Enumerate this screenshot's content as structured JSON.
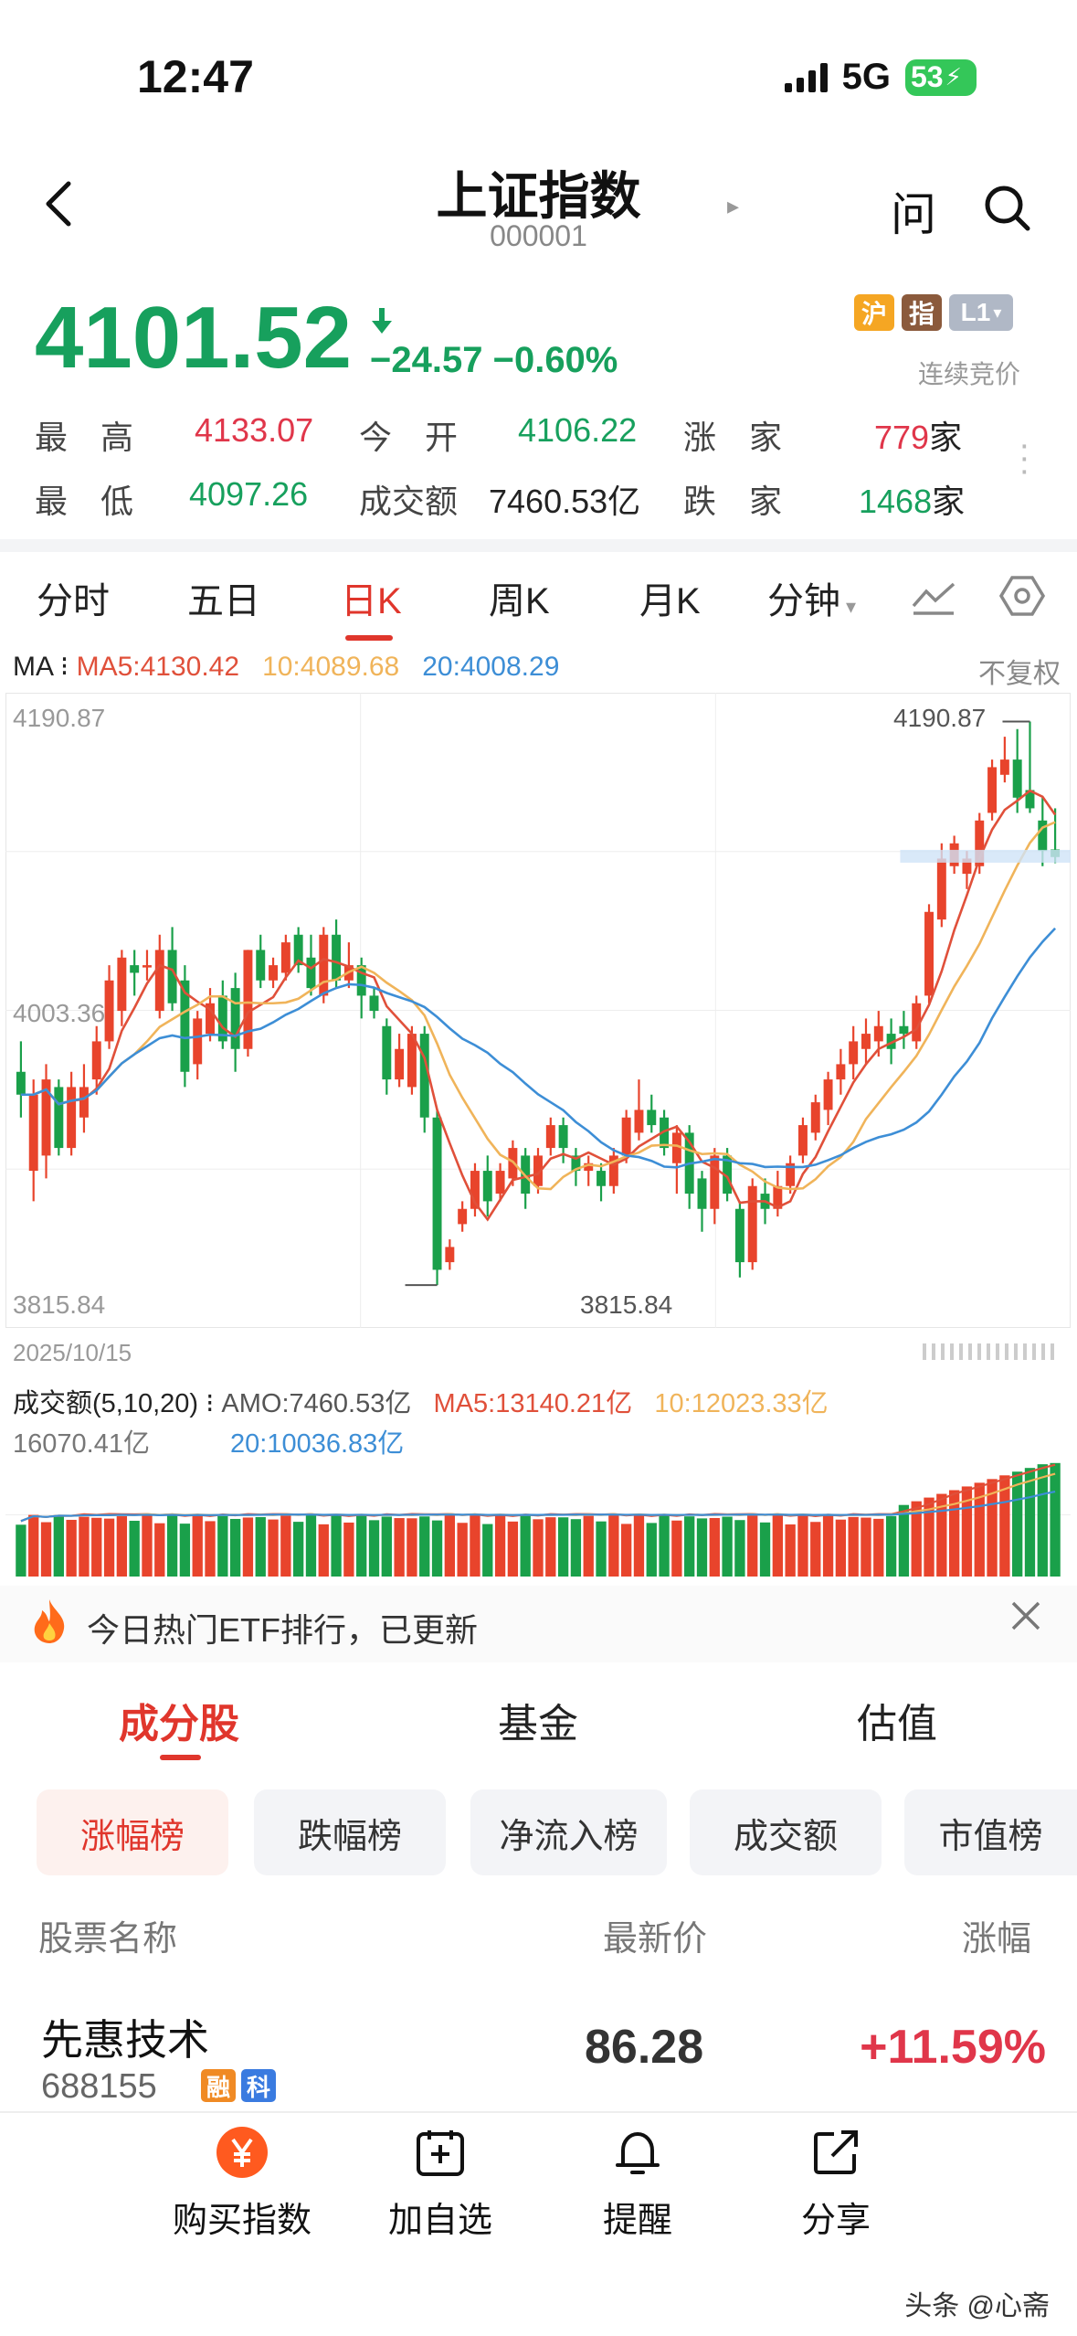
{
  "status": {
    "time": "12:47",
    "network": "5G",
    "battery": "53"
  },
  "header": {
    "title": "上证指数",
    "code": "000001",
    "ask": "问"
  },
  "quote": {
    "price": "4101.52",
    "change": "−24.57",
    "change_pct": "−0.60%",
    "badges": [
      {
        "label": "沪",
        "color": "#f5a623"
      },
      {
        "label": "指",
        "color": "#8b5a3c"
      },
      {
        "label": "L1",
        "color": "#b0b8c6"
      }
    ],
    "mode": "连续竞价"
  },
  "stats": [
    {
      "label": "最　高",
      "value": "4133.07",
      "color": "red"
    },
    {
      "label": "今　开",
      "value": "4106.22",
      "color": "green"
    },
    {
      "label": "涨　家",
      "value": "779",
      "unit": "家",
      "color": "red"
    },
    {
      "label": "最　低",
      "value": "4097.26",
      "color": "green"
    },
    {
      "label": "成交额",
      "value": "7460.53亿",
      "color": "plain"
    },
    {
      "label": "跌　家",
      "value": "1468",
      "unit": "家",
      "color": "green"
    }
  ],
  "period_tabs": [
    "分时",
    "五日",
    "日K",
    "周K",
    "月K",
    "分钟"
  ],
  "active_tab": "日K",
  "ma": {
    "prefix": "MA",
    "ma5": "MA5:4130.42",
    "ma10": "10:4089.68",
    "ma20": "20:4008.29",
    "adjust": "不复权",
    "colors": {
      "ma5": "#e0503a",
      "ma10": "#f0b45a",
      "ma20": "#3d8ed6"
    }
  },
  "chart_data": {
    "type": "candlestick",
    "y_labels": [
      "4190.87",
      "4003.36",
      "3815.84"
    ],
    "high_label": "4190.87",
    "low_label": "3815.84",
    "date": "2025/10/15",
    "ylim": [
      3815.84,
      4190.87
    ],
    "candles": [
      [
        3960,
        3945,
        3980,
        3930
      ],
      [
        3895,
        3945,
        3955,
        3875
      ],
      [
        3905,
        3955,
        3965,
        3890
      ],
      [
        3950,
        3910,
        3955,
        3905
      ],
      [
        3910,
        3950,
        3960,
        3905
      ],
      [
        3930,
        3950,
        3965,
        3920
      ],
      [
        3955,
        3980,
        3990,
        3945
      ],
      [
        3980,
        4020,
        4030,
        3975
      ],
      [
        4000,
        4035,
        4040,
        3990
      ],
      [
        4030,
        4025,
        4040,
        4010
      ],
      [
        4030,
        4030,
        4040,
        4020
      ],
      [
        4000,
        4040,
        4050,
        3995
      ],
      [
        4040,
        4005,
        4055,
        4000
      ],
      [
        4020,
        3960,
        4030,
        3950
      ],
      [
        3965,
        3995,
        4000,
        3955
      ],
      [
        3985,
        4005,
        4015,
        3980
      ],
      [
        4010,
        3980,
        4020,
        3975
      ],
      [
        4015,
        3975,
        4025,
        3960
      ],
      [
        3975,
        4040,
        4040,
        3970
      ],
      [
        4040,
        4020,
        4050,
        4015
      ],
      [
        4020,
        4030,
        4035,
        4015
      ],
      [
        4025,
        4045,
        4050,
        4020
      ],
      [
        4050,
        4030,
        4055,
        4025
      ],
      [
        4035,
        4015,
        4050,
        4010
      ],
      [
        4010,
        4050,
        4055,
        4005
      ],
      [
        4050,
        4020,
        4060,
        4015
      ],
      [
        4020,
        4030,
        4045,
        4015
      ],
      [
        4030,
        4010,
        4035,
        3995
      ],
      [
        4010,
        4000,
        4015,
        3995
      ],
      [
        3990,
        3955,
        3995,
        3945
      ],
      [
        3955,
        3975,
        3985,
        3950
      ],
      [
        3950,
        3985,
        3990,
        3945
      ],
      [
        3985,
        3930,
        3990,
        3920
      ],
      [
        3930,
        3830,
        3935,
        3820
      ],
      [
        3835,
        3845,
        3850,
        3830
      ],
      [
        3860,
        3870,
        3875,
        3855
      ],
      [
        3870,
        3895,
        3900,
        3865
      ],
      [
        3895,
        3875,
        3905,
        3865
      ],
      [
        3880,
        3895,
        3900,
        3875
      ],
      [
        3890,
        3910,
        3915,
        3885
      ],
      [
        3905,
        3880,
        3910,
        3870
      ],
      [
        3885,
        3905,
        3910,
        3880
      ],
      [
        3910,
        3925,
        3930,
        3905
      ],
      [
        3925,
        3910,
        3930,
        3900
      ],
      [
        3905,
        3895,
        3910,
        3885
      ],
      [
        3895,
        3900,
        3905,
        3885
      ],
      [
        3895,
        3885,
        3900,
        3875
      ],
      [
        3885,
        3905,
        3910,
        3880
      ],
      [
        3905,
        3930,
        3935,
        3900
      ],
      [
        3920,
        3935,
        3955,
        3915
      ],
      [
        3935,
        3925,
        3945,
        3920
      ],
      [
        3930,
        3910,
        3935,
        3905
      ],
      [
        3900,
        3920,
        3925,
        3880
      ],
      [
        3920,
        3880,
        3925,
        3870
      ],
      [
        3890,
        3870,
        3895,
        3855
      ],
      [
        3870,
        3905,
        3910,
        3860
      ],
      [
        3905,
        3880,
        3910,
        3875
      ],
      [
        3870,
        3835,
        3875,
        3825
      ],
      [
        3835,
        3885,
        3890,
        3830
      ],
      [
        3880,
        3870,
        3890,
        3860
      ],
      [
        3870,
        3885,
        3895,
        3865
      ],
      [
        3885,
        3900,
        3905,
        3880
      ],
      [
        3905,
        3925,
        3930,
        3900
      ],
      [
        3920,
        3940,
        3945,
        3915
      ],
      [
        3935,
        3955,
        3960,
        3925
      ],
      [
        3955,
        3965,
        3975,
        3945
      ],
      [
        3965,
        3980,
        3990,
        3955
      ],
      [
        3975,
        3985,
        3995,
        3965
      ],
      [
        3980,
        3990,
        4000,
        3970
      ],
      [
        3985,
        3975,
        3995,
        3965
      ],
      [
        3990,
        3985,
        4000,
        3975
      ],
      [
        3980,
        4005,
        4010,
        3975
      ],
      [
        4010,
        4065,
        4070,
        4005
      ],
      [
        4060,
        4100,
        4110,
        4055
      ],
      [
        4095,
        4110,
        4115,
        4090
      ],
      [
        4090,
        4100,
        4105,
        4080
      ],
      [
        4095,
        4125,
        4130,
        4090
      ],
      [
        4130,
        4160,
        4165,
        4125
      ],
      [
        4155,
        4165,
        4180,
        4150
      ],
      [
        4165,
        4140,
        4185,
        4130
      ],
      [
        4145,
        4133,
        4190,
        4130
      ],
      [
        4125,
        4105,
        4140,
        4095
      ],
      [
        4106,
        4101,
        4133,
        4097
      ]
    ]
  },
  "volume": {
    "title": "成交额(5,10,20)",
    "amo": "AMO:7460.53亿",
    "ma5": "MA5:13140.21亿",
    "ma10": "10:12023.33亿",
    "ma20": "20:10036.83亿",
    "max_label": "16070.41亿"
  },
  "banner": {
    "text": "今日热门ETF排行，已更新"
  },
  "sub_tabs": [
    "成分股",
    "基金",
    "估值"
  ],
  "pills": [
    "涨幅榜",
    "跌幅榜",
    "净流入榜",
    "成交额",
    "市值榜"
  ],
  "table": {
    "headers": [
      "股票名称",
      "最新价",
      "涨幅"
    ],
    "rows": [
      {
        "name": "先惠技术",
        "code": "688155",
        "tags": [
          "融",
          "科"
        ],
        "price": "86.28",
        "pct": "+11.59%"
      }
    ]
  },
  "bottom": [
    {
      "label": "购买指数",
      "icon": "yuan-icon"
    },
    {
      "label": "加自选",
      "icon": "add-watchlist-icon"
    },
    {
      "label": "提醒",
      "icon": "bell-icon"
    },
    {
      "label": "分享",
      "icon": "share-icon"
    }
  ],
  "watermark": "头条 @心斋"
}
